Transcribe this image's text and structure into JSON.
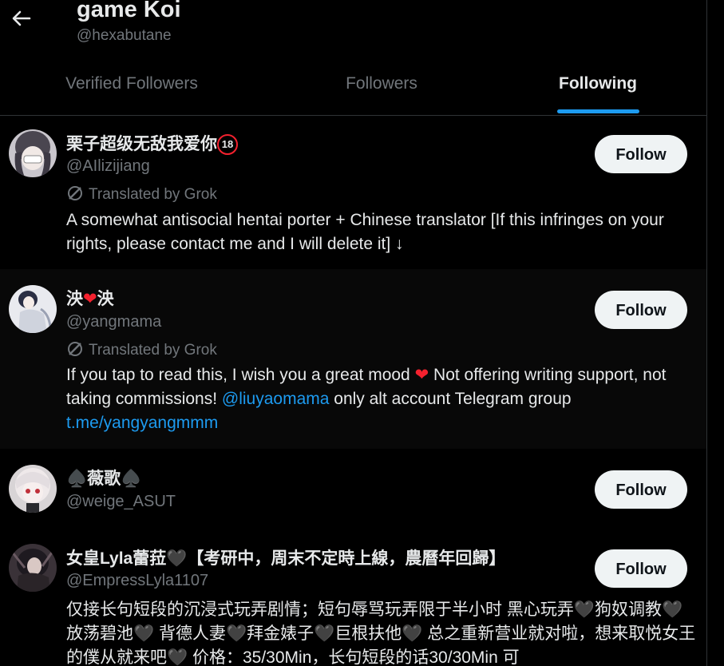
{
  "header": {
    "title": "game Koi",
    "handle": "@hexabutane"
  },
  "tabs": [
    {
      "label": "Verified Followers"
    },
    {
      "label": "Followers"
    },
    {
      "label": "Following"
    }
  ],
  "follow_label": "Follow",
  "accounts": [
    {
      "name": "栗子超级无敌我爱你",
      "badge": "18",
      "username": "@AIlizijiang",
      "translated": "Translated by Grok",
      "bio": "A somewhat antisocial hentai porter + Chinese translator [If this infringes on your rights, please contact me and I will delete it] ↓"
    },
    {
      "name_a": "泱",
      "name_heart": "❤",
      "name_b": "泱",
      "username": "@yangmama",
      "translated": "Translated by Grok",
      "bio_a": "If you tap to read this, I wish you a great mood ",
      "bio_heart": "❤",
      "bio_b": " Not offering writing support, not taking commissions! ",
      "bio_mention": "@liuyaomama",
      "bio_c": " only alt account Telegram group ",
      "bio_link": "t.me/yangyangmmm"
    },
    {
      "name": "♠️薇歌♠️",
      "username": "@weige_ASUT"
    },
    {
      "name": "女皇Lyla蕾菈🖤【考研中，周末不定時上線，農曆年回歸】",
      "username": "@EmpressLyla1107",
      "bio": "仅接长句短段的沉浸式玩弄剧情；短句辱骂玩弄限于半小时 黑心玩弄🖤狗奴调教🖤放荡碧池🖤 背德人妻🖤拜金婊子🖤巨根扶他🖤 总之重新营业就对啦，想来取悦女王的僕从就来吧🖤 价格：35/30Min，长句短段的话30/30Min 可"
    }
  ],
  "colors": {
    "background": "#000000",
    "accent": "#1d9bf0",
    "button_bg": "#eff3f4",
    "muted": "#71767b",
    "heart": "#f4212e"
  }
}
